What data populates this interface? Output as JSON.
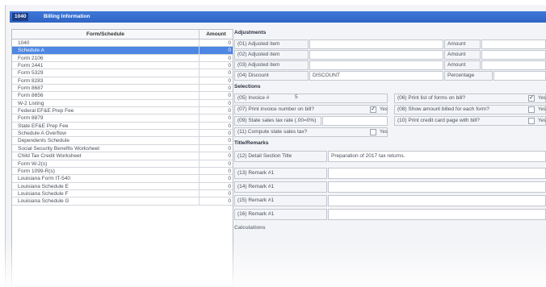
{
  "titlebar": {
    "code": "1040",
    "title": "Billing Information"
  },
  "left": {
    "header": {
      "form": "Form/Schedule",
      "amount": "Amount"
    },
    "rows": [
      {
        "form": "1040",
        "amount": "0"
      },
      {
        "form": "Schedule A",
        "amount": "0",
        "selected": true
      },
      {
        "form": "Form 2106",
        "amount": "0"
      },
      {
        "form": "Form 2441",
        "amount": "0"
      },
      {
        "form": "Form 5329",
        "amount": "0"
      },
      {
        "form": "Form 8283",
        "amount": "0"
      },
      {
        "form": "Form 8687",
        "amount": "0"
      },
      {
        "form": "Form 8656",
        "amount": "0"
      },
      {
        "form": "W-2 Listing",
        "amount": "0"
      },
      {
        "form": "Federal EF&E Prep Fee",
        "amount": "0"
      },
      {
        "form": "Form 8879",
        "amount": "0"
      },
      {
        "form": "State EF&E Prep Fee",
        "amount": "0"
      },
      {
        "form": "Schedule A Overflow",
        "amount": "0"
      },
      {
        "form": "Dependents Schedule",
        "amount": "0"
      },
      {
        "form": "Social Security Benefits Worksheet",
        "amount": "0"
      },
      {
        "form": "Child Tax Credit Worksheet",
        "amount": "0"
      },
      {
        "form": "Form W-2(s)",
        "amount": "0"
      },
      {
        "form": "Form 1099-R(s)",
        "amount": "0"
      },
      {
        "form": "Louisiana Form IT-540",
        "amount": "0"
      },
      {
        "form": "Louisiana Schedule E",
        "amount": "0"
      },
      {
        "form": "Louisiana Schedule F",
        "amount": "0"
      },
      {
        "form": "Louisiana Schedule G",
        "amount": "0"
      }
    ]
  },
  "adjustments": {
    "title": "Adjustments",
    "rows": [
      {
        "label": "(01) Adjusted item",
        "value": "",
        "amount_label": "Amount"
      },
      {
        "label": "(02) Adjusted item",
        "value": "",
        "amount_label": "Amount"
      },
      {
        "label": "(03) Adjusted item",
        "value": "",
        "amount_label": "Amount"
      },
      {
        "label": "(04) Discount",
        "value": "DISCOUNT",
        "amount_label": "Percentage"
      }
    ]
  },
  "selections": {
    "title": "Selections",
    "invoice_label": "(05) Invoice #",
    "invoice_value": "5",
    "print_forms_label": "(06) Print list of forms on bill?",
    "print_forms_yes": "Yes",
    "print_invoice_label": "(07) Print invoice number on bill?",
    "print_invoice_yes": "Yes",
    "show_amount_label": "(08) Show amount billed for each form?",
    "show_amount_yes": "Yes",
    "sales_tax_label": "(09) State sales tax rate (.00=0%)",
    "credit_card_label": "(10) Print credit card page with bill?",
    "credit_card_yes": "Yes",
    "compute_tax_label": "(11) Compute state sales tax?",
    "compute_tax_yes": "Yes"
  },
  "remarks": {
    "title": "Title/Remarks",
    "detail_label": "(12) Detail Section Title",
    "detail_value": "Preparation of 2017 tax returns.",
    "rows": [
      "(13) Remark #1",
      "(14) Remark #1",
      "(15) Remark #1",
      "(16) Remark #1"
    ],
    "next_section": "Calculations"
  }
}
